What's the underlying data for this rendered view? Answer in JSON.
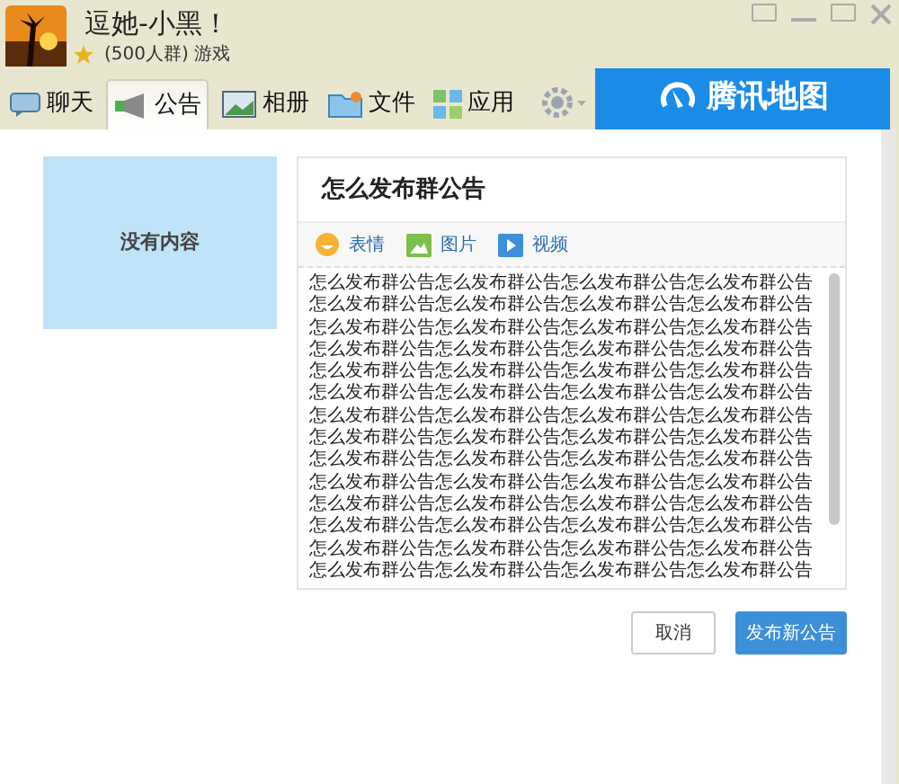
{
  "window": {
    "title": "逗她-小黑！",
    "subtitle": "(500人群) 游戏"
  },
  "tabs": [
    {
      "label": "聊天",
      "kind": "chat",
      "selected": false
    },
    {
      "label": "公告",
      "kind": "notice",
      "selected": true
    },
    {
      "label": "相册",
      "kind": "album",
      "selected": false
    },
    {
      "label": "文件",
      "kind": "file",
      "selected": false
    },
    {
      "label": "应用",
      "kind": "apps",
      "selected": false
    }
  ],
  "banner": {
    "text": "腾讯地图"
  },
  "sidebar": {
    "empty_text": "没有内容"
  },
  "editor": {
    "title": "怎么发布群公告",
    "toolbar": [
      {
        "label": "表情",
        "kind": "emoji"
      },
      {
        "label": "图片",
        "kind": "image"
      },
      {
        "label": "视频",
        "kind": "video"
      }
    ],
    "lines": [
      "怎么发布群公告怎么发布群公告怎么发布群公告怎么发布群公告",
      "怎么发布群公告怎么发布群公告怎么发布群公告怎么发布群公告",
      "怎么发布群公告怎么发布群公告怎么发布群公告怎么发布群公告",
      "怎么发布群公告怎么发布群公告怎么发布群公告怎么发布群公告",
      "怎么发布群公告怎么发布群公告怎么发布群公告怎么发布群公告",
      "怎么发布群公告怎么发布群公告怎么发布群公告怎么发布群公告",
      "怎么发布群公告怎么发布群公告怎么发布群公告怎么发布群公告",
      "怎么发布群公告怎么发布群公告怎么发布群公告怎么发布群公告",
      "怎么发布群公告怎么发布群公告怎么发布群公告怎么发布群公告",
      "怎么发布群公告怎么发布群公告怎么发布群公告怎么发布群公告",
      "怎么发布群公告怎么发布群公告怎么发布群公告怎么发布群公告",
      "怎么发布群公告怎么发布群公告怎么发布群公告怎么发布群公告",
      "怎么发布群公告怎么发布群公告怎么发布群公告怎么发布群公告",
      "怎么发布群公告怎么发布群公告怎么发布群公告怎么发布群公告"
    ]
  },
  "buttons": [
    {
      "label": "取消",
      "kind": "secondary"
    },
    {
      "label": "发布新公告",
      "kind": "primary"
    }
  ]
}
